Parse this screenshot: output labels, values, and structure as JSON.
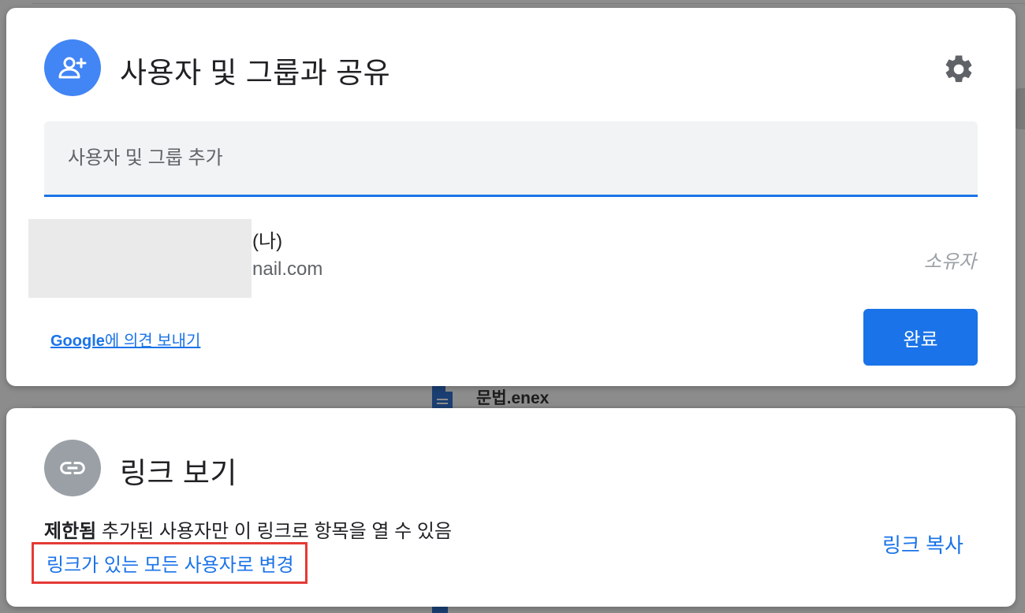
{
  "background": {
    "file_name": "문법.enex"
  },
  "share": {
    "title": "사용자 및 그룹과 공유",
    "input_placeholder": "사용자 및 그룹 추가",
    "user": {
      "name_suffix": "(나)",
      "email_suffix": "nail.com",
      "role": "소유자"
    },
    "feedback_brand": "Google",
    "feedback_text": "에 의견 보내기",
    "done_label": "완료"
  },
  "link": {
    "title": "링크 보기",
    "restricted_label": "제한됨",
    "restricted_desc": "추가된 사용자만 이 링크로 항목을 열 수 있음",
    "change_label": "링크가 있는 모든 사용자로 변경",
    "copy_label": "링크 복사"
  },
  "colors": {
    "accent": "#1a73e8",
    "share_avatar": "#4285f4",
    "link_avatar": "#9aa0a6",
    "highlight_box": "#e53935"
  },
  "icons": {
    "share_avatar": "person-add-icon",
    "settings": "gear-icon",
    "link_avatar": "link-icon",
    "file": "document-icon"
  }
}
